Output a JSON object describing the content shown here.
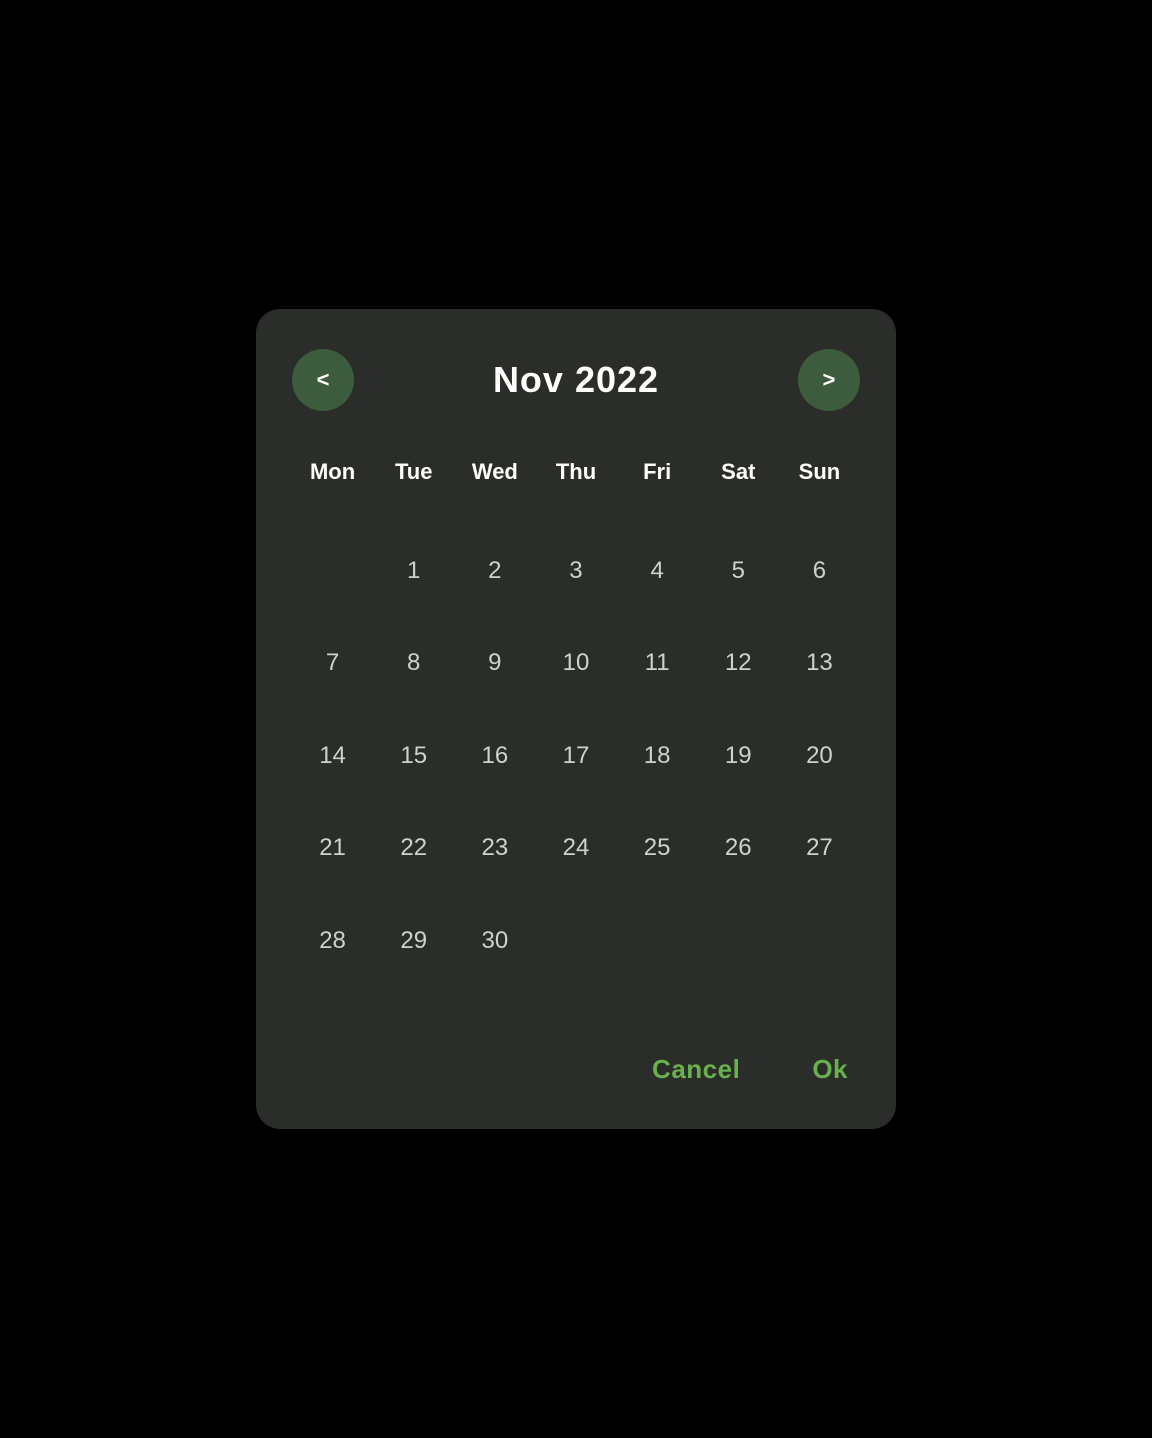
{
  "calendar": {
    "title": "Nov  2022",
    "month": "Nov",
    "year": "2022",
    "prev_button": "<",
    "next_button": ">",
    "day_headers": [
      "Mon",
      "Tue",
      "Wed",
      "Thu",
      "Fri",
      "Sat",
      "Sun"
    ],
    "weeks": [
      [
        "",
        "1",
        "2",
        "3",
        "4",
        "5",
        "6"
      ],
      [
        "7",
        "8",
        "9",
        "10",
        "11",
        "12",
        "13"
      ],
      [
        "14",
        "15",
        "16",
        "17",
        "18",
        "19",
        "20"
      ],
      [
        "21",
        "22",
        "23",
        "24",
        "25",
        "26",
        "27"
      ],
      [
        "28",
        "29",
        "30",
        "",
        "",
        "",
        ""
      ]
    ],
    "cancel_label": "Cancel",
    "ok_label": "Ok"
  },
  "colors": {
    "background": "#000000",
    "dialog_bg": "#2a2d2a",
    "nav_button_bg": "#3d5c3d",
    "title_color": "#ffffff",
    "day_header_color": "#ffffff",
    "day_color": "#d0d0d0",
    "action_color": "#6ab04c"
  }
}
